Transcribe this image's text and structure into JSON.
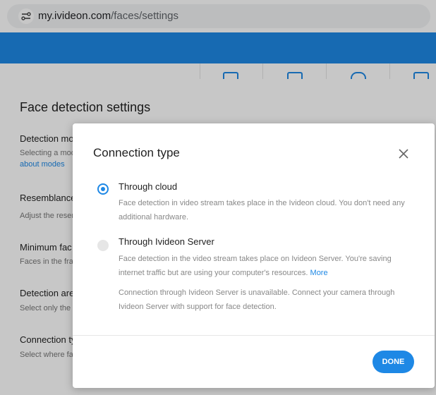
{
  "browser": {
    "url_host": "my.ivideon.com",
    "url_path": "/faces/settings"
  },
  "background": {
    "title": "Face detection settings",
    "sections": [
      {
        "label": "Detection mo",
        "sub": "Selecting a mod",
        "link": "about modes"
      },
      {
        "label": "Resemblance",
        "sub": "Adjust the resen"
      },
      {
        "label": "Minimum fac",
        "sub": "Faces in the fra"
      },
      {
        "label": "Detection are",
        "sub": "Select only the c"
      },
      {
        "label": "Connection ty",
        "sub": "Select where fa"
      }
    ]
  },
  "modal": {
    "title": "Connection type",
    "options": [
      {
        "label": "Through cloud",
        "selected": true,
        "description": "Face detection in video stream takes place in the Ivideon cloud. You don't need any additional hardware."
      },
      {
        "label": "Through Ivideon Server",
        "selected": false,
        "description": "Face detection in the video stream takes place on Ivideon Server. You're saving internet traffic but are using your computer's resources.",
        "more_link": "More",
        "note": "Connection through Ivideon Server is unavailable. Connect your camera through Ivideon Server with support for face detection."
      }
    ],
    "done_label": "DONE"
  },
  "colors": {
    "accent": "#1e88e5",
    "muted_text": "#888888"
  }
}
